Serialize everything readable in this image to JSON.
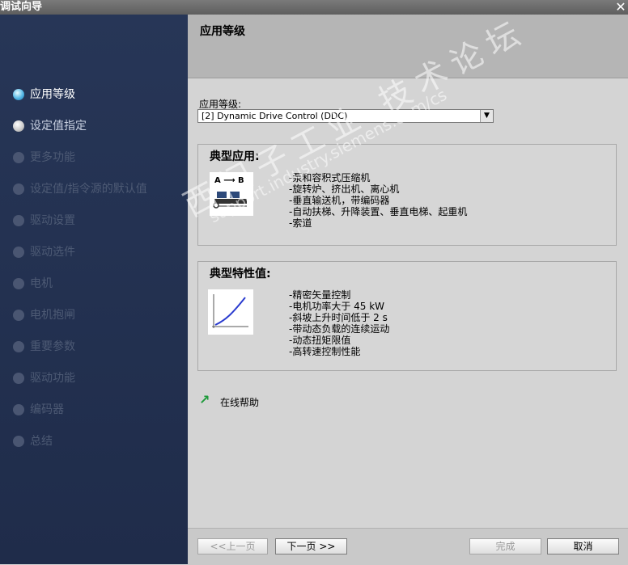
{
  "window": {
    "title": "调试向导",
    "close_symbol": "✕"
  },
  "sidebar": {
    "items": [
      {
        "label": "应用等级",
        "state": "active"
      },
      {
        "label": "设定值指定",
        "state": "enabled"
      },
      {
        "label": "更多功能",
        "state": "disabled"
      },
      {
        "label": "设定值/指令源的默认值",
        "state": "disabled"
      },
      {
        "label": "驱动设置",
        "state": "disabled"
      },
      {
        "label": "驱动选件",
        "state": "disabled"
      },
      {
        "label": "电机",
        "state": "disabled"
      },
      {
        "label": "电机抱闸",
        "state": "disabled"
      },
      {
        "label": "重要参数",
        "state": "disabled"
      },
      {
        "label": "驱动功能",
        "state": "disabled"
      },
      {
        "label": "编码器",
        "state": "disabled"
      },
      {
        "label": "总结",
        "state": "disabled"
      }
    ]
  },
  "header": {
    "title": "应用等级"
  },
  "form": {
    "level_label": "应用等级:",
    "level_value": "[2] Dynamic Drive Control (DDC)"
  },
  "typical_apps": {
    "title": "典型应用:",
    "image_text": "A ⟶ B",
    "items": [
      "-泵和容积式压缩机",
      "-旋转炉、挤出机、离心机",
      "-垂直输送机，带编码器",
      "-自动扶梯、升降装置、垂直电梯、起重机",
      "-索道"
    ]
  },
  "typical_chars": {
    "title": "典型特性值:",
    "items": [
      "-精密矢量控制",
      "-电机功率大于 45 kW",
      "-斜坡上升时间低于 2 s",
      "-带动态负载的连续运动",
      "-动态扭矩限值",
      "-高转速控制性能"
    ]
  },
  "help": {
    "label": "在线帮助"
  },
  "footer": {
    "prev": "<<上一页",
    "next": "下一页 >>",
    "finish": "完成",
    "cancel": "取消"
  },
  "watermark": {
    "line1": "西门子工业 技术论坛",
    "line2": "support.industry.siemens.com/cs"
  }
}
